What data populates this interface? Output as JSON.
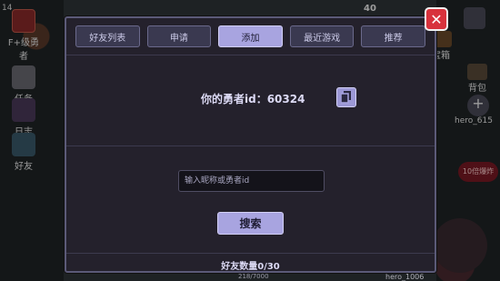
{
  "hud_left": {
    "level": "14",
    "rank_label": "F+级勇者",
    "task_label": "任务",
    "log_label": "日志",
    "friend_label": "好友"
  },
  "hud_right": {
    "top_value": "40",
    "treasure_label": "宝箱",
    "backpack_label": "背包",
    "player_label": "hero_615",
    "badge_label": "10倍爆炸"
  },
  "bottom_hud": {
    "exp_text": "218/7000",
    "player_text": "hero_1006"
  },
  "dialog": {
    "tabs": [
      {
        "label": "好友列表",
        "active": false
      },
      {
        "label": "申请",
        "active": false
      },
      {
        "label": "添加",
        "active": true
      },
      {
        "label": "最近游戏",
        "active": false
      },
      {
        "label": "推荐",
        "active": false
      }
    ],
    "id_text": "你的勇者id：60324",
    "search_placeholder": "输入昵称或勇者id",
    "search_button": "搜索",
    "friend_count": "好友数量0/30",
    "close_label": "✕"
  }
}
